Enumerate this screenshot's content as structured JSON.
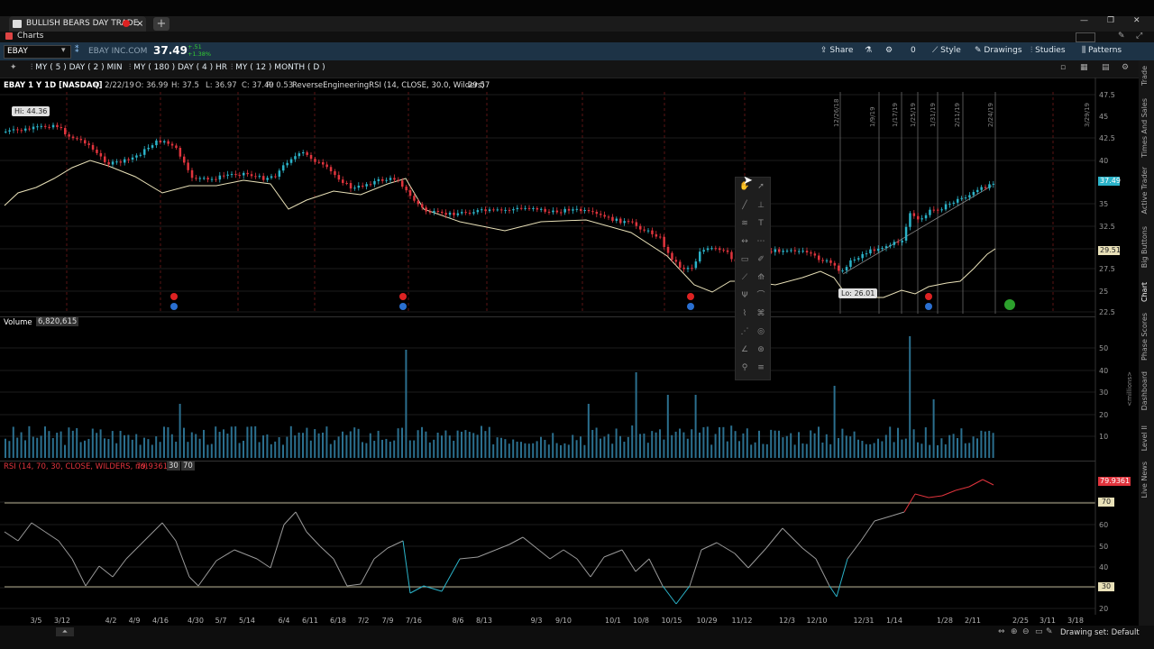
{
  "window": {
    "tab_title": "BULLISH BEARS DAY TRADE",
    "new_tab": "+",
    "close": "×"
  },
  "charts_label": "Charts",
  "toolbar": {
    "symbol": "EBAY",
    "company": "EBAY INC.COM",
    "last": "37.49",
    "change": "+.51",
    "change_pct": "+1.38%",
    "share": "Share",
    "alerts_count": "0",
    "style": "Style",
    "drawings": "Drawings",
    "studies": "Studies",
    "patterns": "Patterns"
  },
  "grid_presets": [
    {
      "label": "MY ( 5 ) DAY ( 2 ) MIN"
    },
    {
      "label": "MY ( 180 ) DAY ( 4 ) HR"
    },
    {
      "label": "MY ( 12 ) MONTH ( D )"
    }
  ],
  "price_pane": {
    "header": "EBAY 1 Y 1D [NASDAQ]",
    "date": "D: 2/22/19",
    "open": "O: 36.99",
    "high": "H: 37.5",
    "low": "L: 36.97",
    "close": "C: 37.49",
    "range": "R: 0.53",
    "study": "ReverseEngineeringRSI (14, CLOSE, 30.0, Wilders)",
    "study_value": "29.57",
    "hi_label": "Hi: 44.36",
    "lo_label": "Lo: 26.01",
    "price_tag": "37.49",
    "study_tag": "29.51",
    "y_ticks": [
      "47.5",
      "45",
      "42.5",
      "40",
      "35",
      "32.5",
      "30",
      "27.5",
      "25",
      "22.5"
    ],
    "vertical_labels": [
      "12/26/18",
      "1/9/19",
      "1/17/19",
      "1/25/19",
      "1/31/19",
      "2/11/19",
      "2/24/19",
      "3/29/19"
    ]
  },
  "volume_pane": {
    "title": "Volume",
    "value": "6,820,615",
    "y_ticks": [
      "50",
      "40",
      "30",
      "20",
      "10"
    ],
    "unit": "<millions>"
  },
  "rsi_pane": {
    "title": "RSI (14, 70, 30, CLOSE, WILDERS, no)",
    "value": "79.9361",
    "ob": "30",
    "os": "70",
    "y_ticks": [
      "70",
      "60",
      "50",
      "40",
      "30",
      "20"
    ],
    "tag_value": "79.9361",
    "tag_70": "70",
    "tag_30": "30"
  },
  "x_axis": [
    "3/5",
    "3/12",
    "4/2",
    "4/9",
    "4/16",
    "4/30",
    "5/7",
    "5/14",
    "6/4",
    "6/11",
    "6/18",
    "7/2",
    "7/9",
    "7/16",
    "8/6",
    "8/13",
    "9/3",
    "9/10",
    "10/1",
    "10/8",
    "10/15",
    "10/29",
    "11/12",
    "12/3",
    "12/10",
    "12/31",
    "1/14",
    "1/28",
    "2/11",
    "2/25",
    "3/11",
    "3/18"
  ],
  "right_rail": [
    "Trade",
    "Times And Sales",
    "Active Trader",
    "Big Buttons",
    "Chart",
    "Phase Scores",
    "Dashboard",
    "Level II",
    "Live News"
  ],
  "status": {
    "drawing_set": "Drawing set: Default"
  },
  "colors": {
    "up": "#2bb3c9",
    "down": "#e0343d",
    "sma": "#e9e1b8",
    "toolbar_bg": "#1d3346"
  }
}
